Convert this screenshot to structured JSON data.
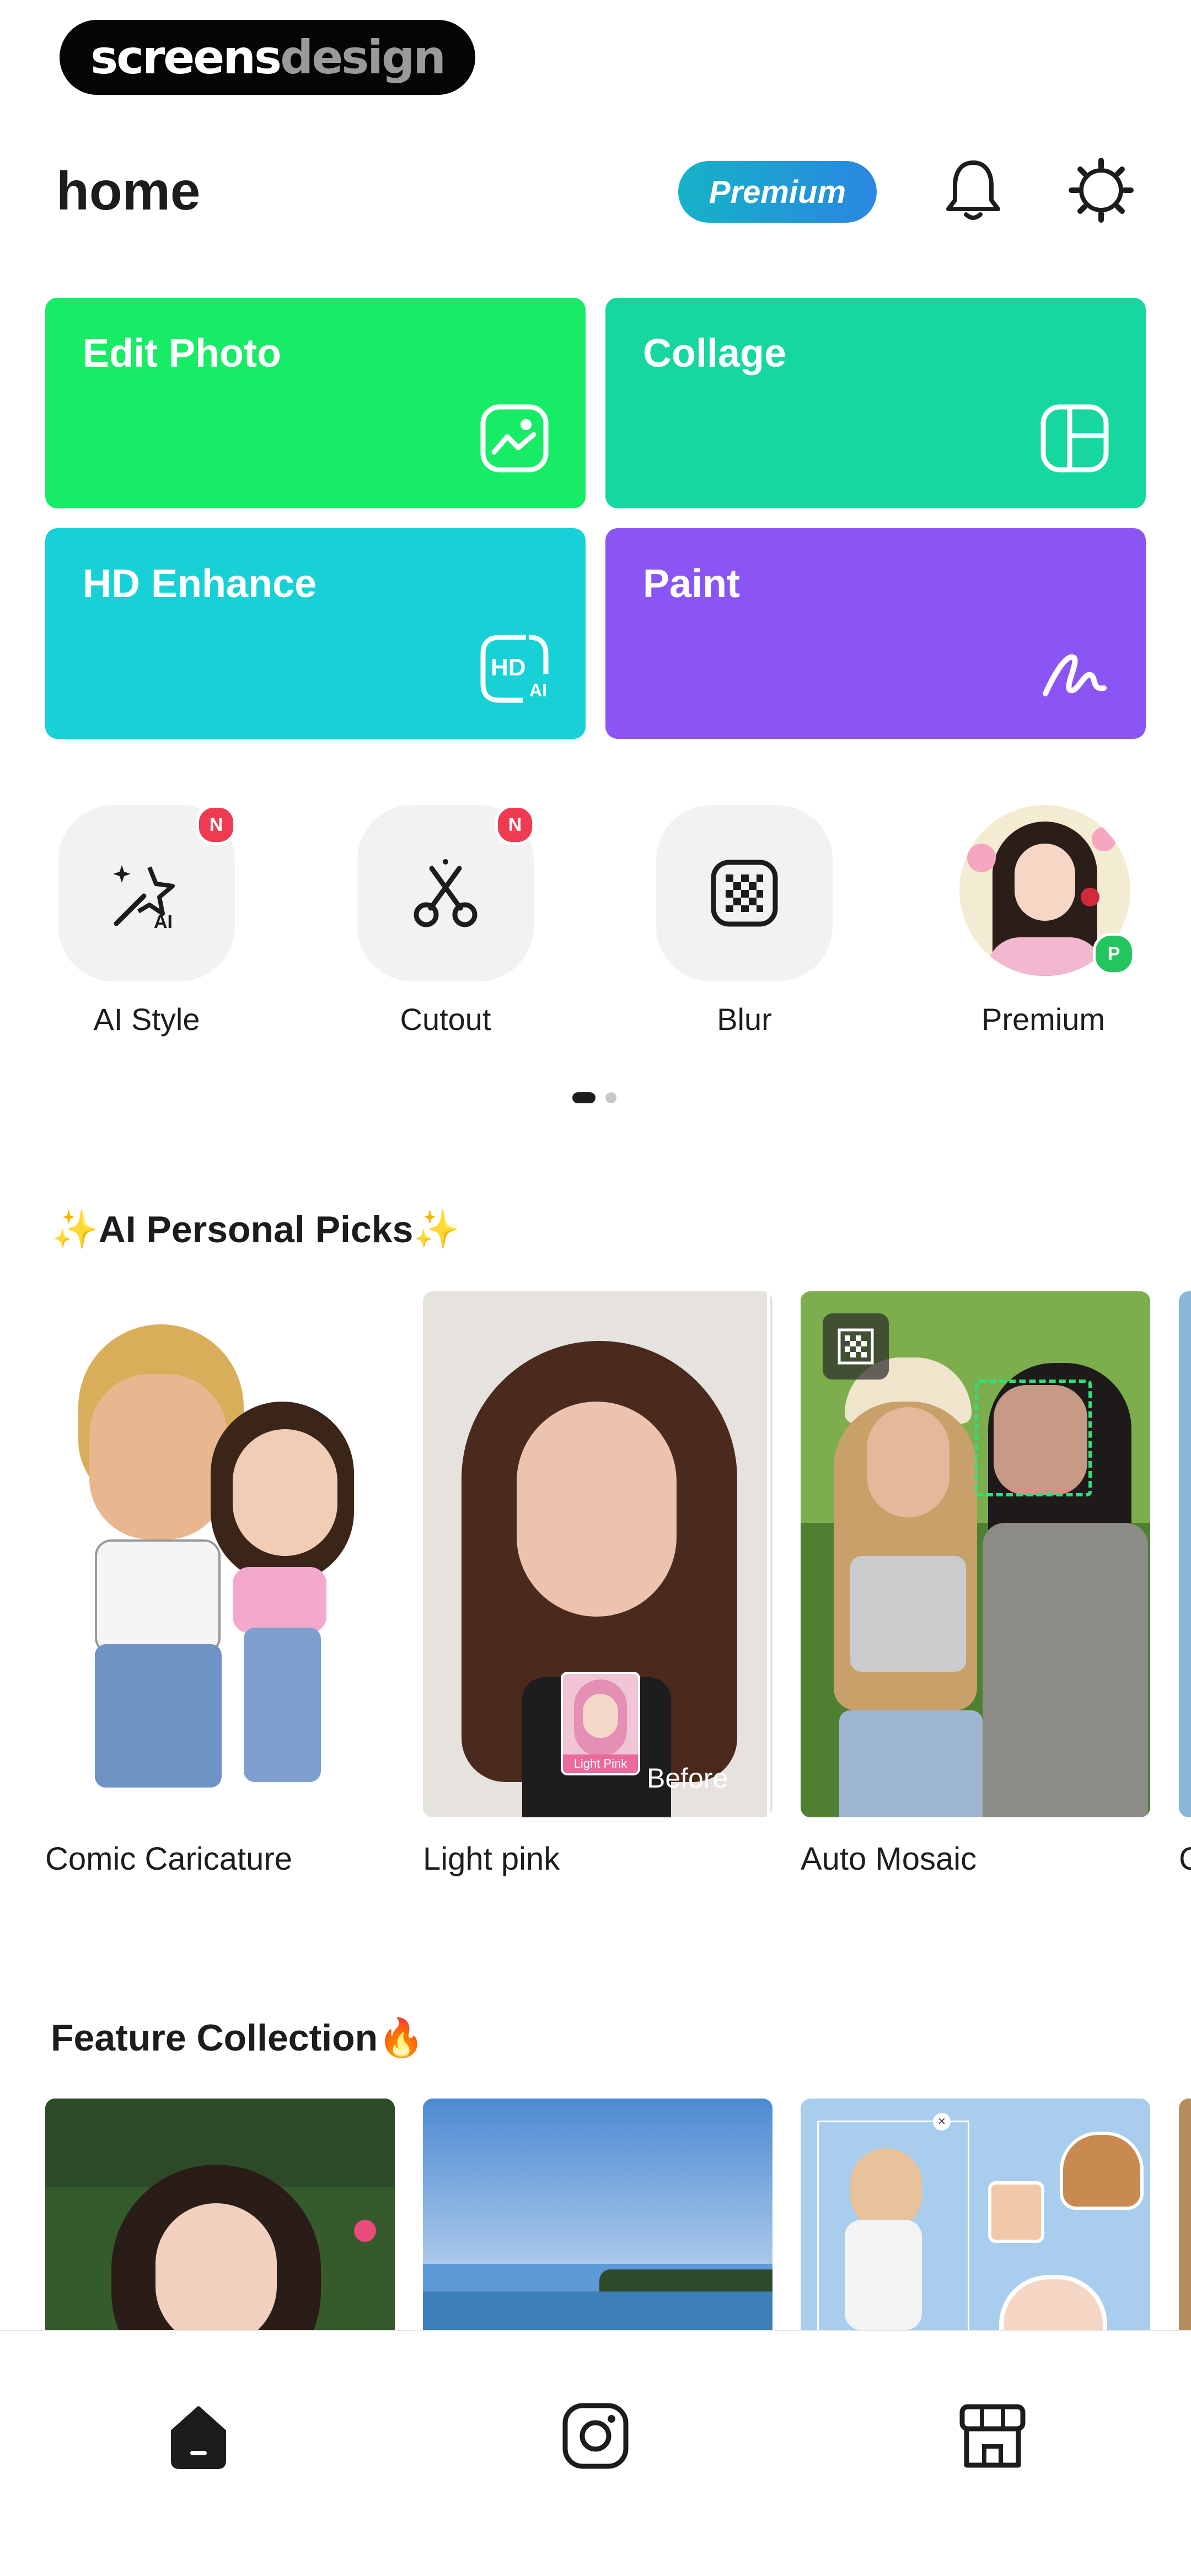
{
  "watermark": {
    "part1": "screens",
    "part2": "design"
  },
  "header": {
    "title": "home",
    "premium_label": "Premium"
  },
  "icons": {
    "notifications": "bell-icon",
    "settings": "gear-icon"
  },
  "tiles": [
    {
      "label": "Edit Photo",
      "color": "#18ec66",
      "icon": "photo-icon"
    },
    {
      "label": "Collage",
      "color": "#16d79f",
      "icon": "collage-icon"
    },
    {
      "label": "HD Enhance",
      "color": "#17d1d6",
      "icon": "hd-ai-icon",
      "icon_text": "HD",
      "icon_sub": "AI"
    },
    {
      "label": "Paint",
      "color": "#8b55f6",
      "icon": "paint-stroke-icon"
    }
  ],
  "tools": [
    {
      "label": "AI Style",
      "badge": "N",
      "icon": "magic-wand-ai-icon",
      "icon_text": "AI"
    },
    {
      "label": "Cutout",
      "badge": "N",
      "icon": "scissors-icon"
    },
    {
      "label": "Blur",
      "icon": "mosaic-icon"
    },
    {
      "label": "Premium",
      "icon": "avatar",
      "badge": "P"
    }
  ],
  "pager": {
    "pages": 2,
    "active": 1
  },
  "sections": {
    "picks_title": "✨AI Personal Picks✨",
    "features_title": "Feature Collection🔥"
  },
  "picks": [
    {
      "label": "Comic Caricature"
    },
    {
      "label": "Light pink",
      "inset_label": "Light Pink",
      "overlay": "Before"
    },
    {
      "label": "Auto Mosaic"
    },
    {
      "label": "C"
    }
  ],
  "colors": {
    "accent_green": "#18ec66",
    "premium_gradient_start": "#15b3c7",
    "premium_gradient_end": "#2a86e0",
    "badge_red": "#ef3b52",
    "premium_badge_green": "#22c55e"
  },
  "tabbar": [
    {
      "name": "home",
      "icon": "home-icon",
      "active": true
    },
    {
      "name": "instagram",
      "icon": "instagram-icon",
      "active": false
    },
    {
      "name": "store",
      "icon": "store-icon",
      "active": false
    }
  ]
}
